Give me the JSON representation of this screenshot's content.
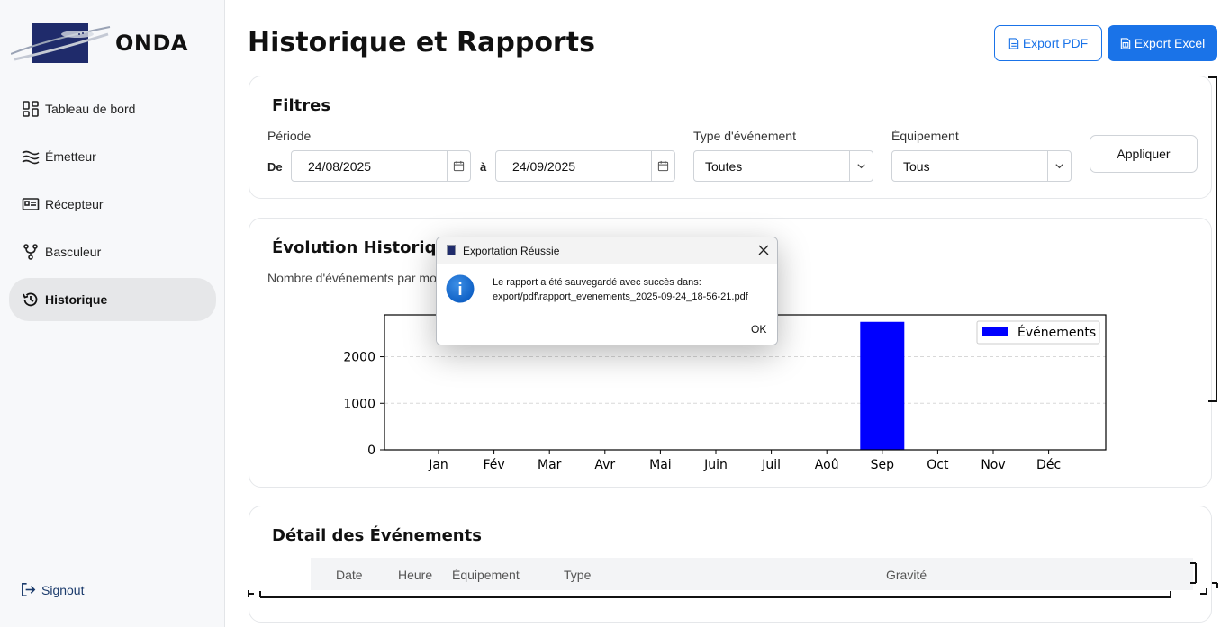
{
  "brand": {
    "name": "ONDA"
  },
  "sidebar": {
    "items": [
      {
        "label": "Tableau de bord",
        "icon": "dashboard-icon"
      },
      {
        "label": "Émetteur",
        "icon": "waves-icon"
      },
      {
        "label": "Récepteur",
        "icon": "receiver-icon"
      },
      {
        "label": "Basculeur",
        "icon": "fork-icon"
      },
      {
        "label": "Historique",
        "icon": "history-icon",
        "active": true
      }
    ],
    "signout": "Signout"
  },
  "header": {
    "title": "Historique et Rapports",
    "export_pdf": "Export PDF",
    "export_excel": "Export Excel"
  },
  "filters": {
    "title": "Filtres",
    "period_label": "Période",
    "from_label": "De",
    "from_value": "24/08/2025",
    "to_label": "à",
    "to_value": "24/09/2025",
    "event_type_label": "Type d'événement",
    "event_type_value": "Toutes",
    "equipment_label": "Équipement",
    "equipment_value": "Tous",
    "apply": "Appliquer"
  },
  "chart_section": {
    "title": "Évolution Historique",
    "subtitle": "Nombre d'événements par mo"
  },
  "chart_data": {
    "type": "bar",
    "categories": [
      "Jan",
      "Fév",
      "Mar",
      "Avr",
      "Mai",
      "Juin",
      "Juil",
      "Aoû",
      "Sep",
      "Oct",
      "Nov",
      "Déc"
    ],
    "series": [
      {
        "name": "Événements",
        "values": [
          0,
          0,
          0,
          0,
          0,
          0,
          0,
          0,
          2750,
          0,
          0,
          0
        ],
        "color": "#0000ff"
      }
    ],
    "yticks": [
      0,
      1000,
      2000
    ],
    "ylim": [
      0,
      2900
    ],
    "grid": "horizontal-dashed",
    "legend": "top-right"
  },
  "detail": {
    "title": "Détail des Événements",
    "columns": [
      "Date",
      "Heure",
      "Équipement",
      "Type",
      "Gravité"
    ]
  },
  "dialog": {
    "title": "Exportation Réussie",
    "message_line1": "Le rapport a été sauvegardé avec succès dans:",
    "message_line2": "export/pdf\\rapport_evenements_2025-09-24_18-56-21.pdf",
    "ok": "OK"
  },
  "colors": {
    "accent": "#1a73e8",
    "bar": "#0000ff",
    "info": "#1a73e8"
  }
}
